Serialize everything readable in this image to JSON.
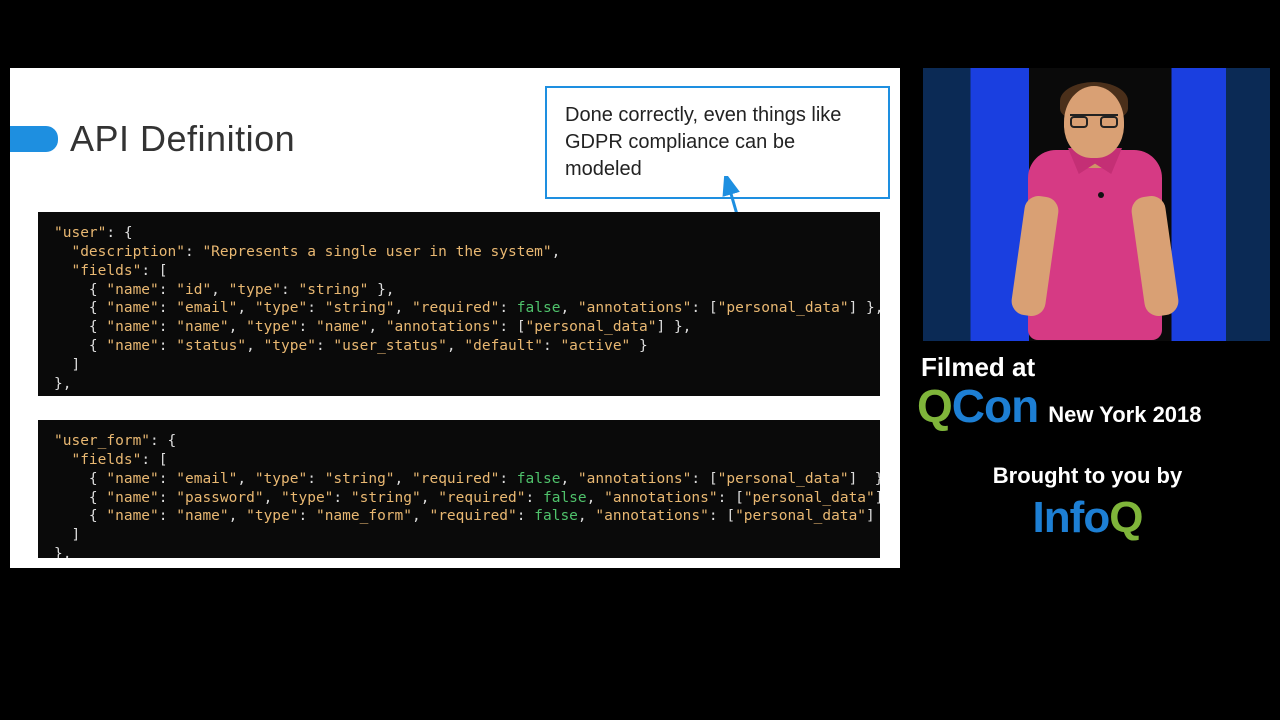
{
  "slide": {
    "title": "API Definition",
    "callout": "Done correctly, even things like GDPR compliance can be modeled",
    "code1_tokens": [
      {
        "t": "key",
        "v": "\"user\""
      },
      {
        "t": "punc",
        "v": ": {"
      },
      {
        "t": "nl"
      },
      {
        "t": "punc",
        "v": "  "
      },
      {
        "t": "key",
        "v": "\"description\""
      },
      {
        "t": "punc",
        "v": ": "
      },
      {
        "t": "str",
        "v": "\"Represents a single user in the system\""
      },
      {
        "t": "punc",
        "v": ","
      },
      {
        "t": "nl"
      },
      {
        "t": "punc",
        "v": "  "
      },
      {
        "t": "key",
        "v": "\"fields\""
      },
      {
        "t": "punc",
        "v": ": ["
      },
      {
        "t": "nl"
      },
      {
        "t": "punc",
        "v": "    { "
      },
      {
        "t": "key",
        "v": "\"name\""
      },
      {
        "t": "punc",
        "v": ": "
      },
      {
        "t": "str",
        "v": "\"id\""
      },
      {
        "t": "punc",
        "v": ", "
      },
      {
        "t": "key",
        "v": "\"type\""
      },
      {
        "t": "punc",
        "v": ": "
      },
      {
        "t": "str",
        "v": "\"string\""
      },
      {
        "t": "punc",
        "v": " },"
      },
      {
        "t": "nl"
      },
      {
        "t": "punc",
        "v": "    { "
      },
      {
        "t": "key",
        "v": "\"name\""
      },
      {
        "t": "punc",
        "v": ": "
      },
      {
        "t": "str",
        "v": "\"email\""
      },
      {
        "t": "punc",
        "v": ", "
      },
      {
        "t": "key",
        "v": "\"type\""
      },
      {
        "t": "punc",
        "v": ": "
      },
      {
        "t": "str",
        "v": "\"string\""
      },
      {
        "t": "punc",
        "v": ", "
      },
      {
        "t": "key",
        "v": "\"required\""
      },
      {
        "t": "punc",
        "v": ": "
      },
      {
        "t": "bool",
        "v": "false"
      },
      {
        "t": "punc",
        "v": ", "
      },
      {
        "t": "key",
        "v": "\"annotations\""
      },
      {
        "t": "punc",
        "v": ": ["
      },
      {
        "t": "str",
        "v": "\"personal_data\""
      },
      {
        "t": "punc",
        "v": "] },"
      },
      {
        "t": "nl"
      },
      {
        "t": "punc",
        "v": "    { "
      },
      {
        "t": "key",
        "v": "\"name\""
      },
      {
        "t": "punc",
        "v": ": "
      },
      {
        "t": "str",
        "v": "\"name\""
      },
      {
        "t": "punc",
        "v": ", "
      },
      {
        "t": "key",
        "v": "\"type\""
      },
      {
        "t": "punc",
        "v": ": "
      },
      {
        "t": "str",
        "v": "\"name\""
      },
      {
        "t": "punc",
        "v": ", "
      },
      {
        "t": "key",
        "v": "\"annotations\""
      },
      {
        "t": "punc",
        "v": ": ["
      },
      {
        "t": "str",
        "v": "\"personal_data\""
      },
      {
        "t": "punc",
        "v": "] },"
      },
      {
        "t": "nl"
      },
      {
        "t": "punc",
        "v": "    { "
      },
      {
        "t": "key",
        "v": "\"name\""
      },
      {
        "t": "punc",
        "v": ": "
      },
      {
        "t": "str",
        "v": "\"status\""
      },
      {
        "t": "punc",
        "v": ", "
      },
      {
        "t": "key",
        "v": "\"type\""
      },
      {
        "t": "punc",
        "v": ": "
      },
      {
        "t": "str",
        "v": "\"user_status\""
      },
      {
        "t": "punc",
        "v": ", "
      },
      {
        "t": "key",
        "v": "\"default\""
      },
      {
        "t": "punc",
        "v": ": "
      },
      {
        "t": "str",
        "v": "\"active\""
      },
      {
        "t": "punc",
        "v": " }"
      },
      {
        "t": "nl"
      },
      {
        "t": "punc",
        "v": "  ]"
      },
      {
        "t": "nl"
      },
      {
        "t": "punc",
        "v": "},"
      }
    ],
    "code2_tokens": [
      {
        "t": "key",
        "v": "\"user_form\""
      },
      {
        "t": "punc",
        "v": ": {"
      },
      {
        "t": "nl"
      },
      {
        "t": "punc",
        "v": "  "
      },
      {
        "t": "key",
        "v": "\"fields\""
      },
      {
        "t": "punc",
        "v": ": ["
      },
      {
        "t": "nl"
      },
      {
        "t": "punc",
        "v": "    { "
      },
      {
        "t": "key",
        "v": "\"name\""
      },
      {
        "t": "punc",
        "v": ": "
      },
      {
        "t": "str",
        "v": "\"email\""
      },
      {
        "t": "punc",
        "v": ", "
      },
      {
        "t": "key",
        "v": "\"type\""
      },
      {
        "t": "punc",
        "v": ": "
      },
      {
        "t": "str",
        "v": "\"string\""
      },
      {
        "t": "punc",
        "v": ", "
      },
      {
        "t": "key",
        "v": "\"required\""
      },
      {
        "t": "punc",
        "v": ": "
      },
      {
        "t": "bool",
        "v": "false"
      },
      {
        "t": "punc",
        "v": ", "
      },
      {
        "t": "key",
        "v": "\"annotations\""
      },
      {
        "t": "punc",
        "v": ": ["
      },
      {
        "t": "str",
        "v": "\"personal_data\""
      },
      {
        "t": "punc",
        "v": "]  },"
      },
      {
        "t": "nl"
      },
      {
        "t": "punc",
        "v": "    { "
      },
      {
        "t": "key",
        "v": "\"name\""
      },
      {
        "t": "punc",
        "v": ": "
      },
      {
        "t": "str",
        "v": "\"password\""
      },
      {
        "t": "punc",
        "v": ", "
      },
      {
        "t": "key",
        "v": "\"type\""
      },
      {
        "t": "punc",
        "v": ": "
      },
      {
        "t": "str",
        "v": "\"string\""
      },
      {
        "t": "punc",
        "v": ", "
      },
      {
        "t": "key",
        "v": "\"required\""
      },
      {
        "t": "punc",
        "v": ": "
      },
      {
        "t": "bool",
        "v": "false"
      },
      {
        "t": "punc",
        "v": ", "
      },
      {
        "t": "key",
        "v": "\"annotations\""
      },
      {
        "t": "punc",
        "v": ": ["
      },
      {
        "t": "str",
        "v": "\"personal_data\""
      },
      {
        "t": "punc",
        "v": "]  },"
      },
      {
        "t": "nl"
      },
      {
        "t": "punc",
        "v": "    { "
      },
      {
        "t": "key",
        "v": "\"name\""
      },
      {
        "t": "punc",
        "v": ": "
      },
      {
        "t": "str",
        "v": "\"name\""
      },
      {
        "t": "punc",
        "v": ", "
      },
      {
        "t": "key",
        "v": "\"type\""
      },
      {
        "t": "punc",
        "v": ": "
      },
      {
        "t": "str",
        "v": "\"name_form\""
      },
      {
        "t": "punc",
        "v": ", "
      },
      {
        "t": "key",
        "v": "\"required\""
      },
      {
        "t": "punc",
        "v": ": "
      },
      {
        "t": "bool",
        "v": "false"
      },
      {
        "t": "punc",
        "v": ", "
      },
      {
        "t": "key",
        "v": "\"annotations\""
      },
      {
        "t": "punc",
        "v": ": ["
      },
      {
        "t": "str",
        "v": "\"personal_data\""
      },
      {
        "t": "punc",
        "v": "]  }"
      },
      {
        "t": "nl"
      },
      {
        "t": "punc",
        "v": "  ]"
      },
      {
        "t": "nl"
      },
      {
        "t": "punc",
        "v": "},"
      }
    ]
  },
  "branding": {
    "filmed": "Filmed at",
    "qcon_letters": {
      "q": "Q",
      "c": "C",
      "o": "o",
      "n": "n"
    },
    "qcon_location": "New York 2018",
    "brought": "Brought to you by",
    "infoq_letters": {
      "i": "I",
      "n": "n",
      "f": "f",
      "o": "o",
      "q": "Q"
    }
  }
}
